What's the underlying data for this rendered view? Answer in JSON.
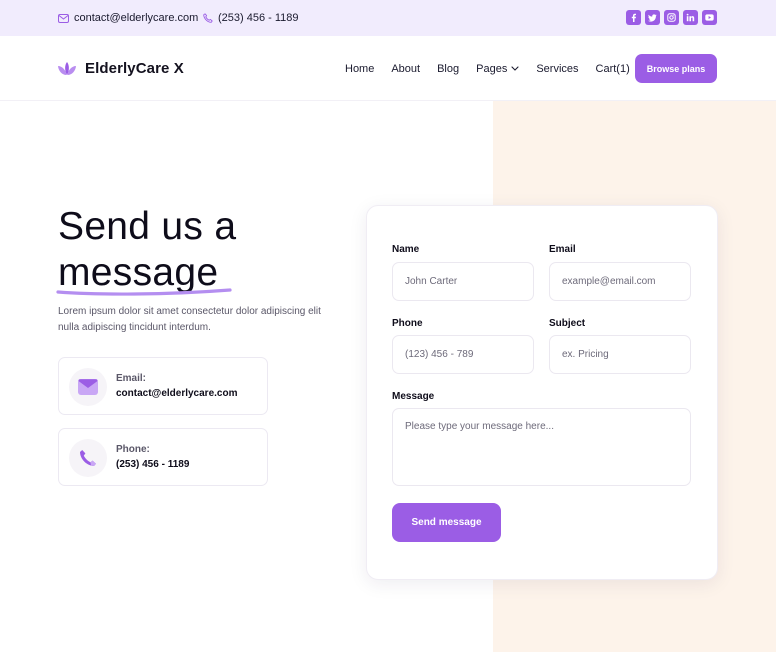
{
  "topbar": {
    "email": "contact@elderlycare.com",
    "phone": "(253) 456 - 1189",
    "socials": [
      "facebook-icon",
      "twitter-icon",
      "instagram-icon",
      "linkedin-icon",
      "youtube-icon"
    ]
  },
  "brand": {
    "name": "ElderlyCare X",
    "logo_icon": "lotus-icon",
    "accent": "#9b5de5",
    "peach": "#fdf3ea"
  },
  "nav": {
    "items": [
      "Home",
      "About",
      "Blog",
      "Pages",
      "Services",
      "Cart(1)"
    ],
    "cta": "Browse plans"
  },
  "hero": {
    "heading_line1": "Send us a",
    "heading_line2": "message",
    "intro": "Lorem ipsum dolor sit amet consectetur dolor adipiscing elit nulla adipiscing tincidunt interdum."
  },
  "contact_cards": [
    {
      "label": "Email:",
      "value": "contact@elderlycare.com",
      "icon": "envelope-icon"
    },
    {
      "label": "Phone:",
      "value": "(253) 456 - 1189",
      "icon": "phone-icon"
    }
  ],
  "form": {
    "name_label": "Name",
    "name_placeholder": "John Carter",
    "email_label": "Email",
    "email_placeholder": "example@email.com",
    "phone_label": "Phone",
    "phone_placeholder": "(123) 456 - 789",
    "subject_label": "Subject",
    "subject_placeholder": "ex. Pricing",
    "message_label": "Message",
    "message_placeholder": "Please type your message here...",
    "submit": "Send message"
  }
}
